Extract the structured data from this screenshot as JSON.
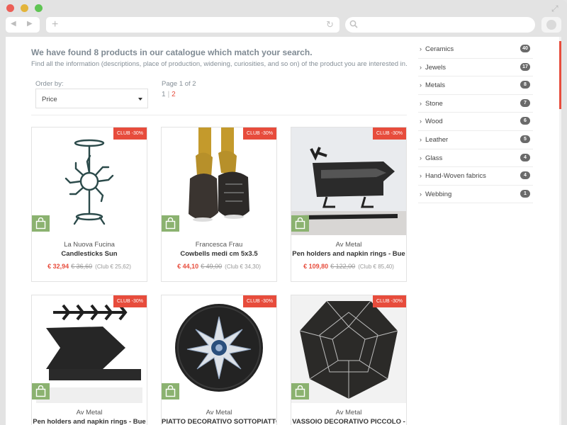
{
  "search": {
    "heading": "We have found 8 products in our catalogue which match your search.",
    "subheading": "Find all the information (descriptions, place of production, widening, curiosities, and so on) of the product you are interested in."
  },
  "order": {
    "label": "Order by:",
    "value": "Price"
  },
  "pagination": {
    "label": "Page 1 of 2",
    "current": "1",
    "separator": "|",
    "next": "2"
  },
  "products": [
    {
      "badge": "CLUB -30%",
      "maker": "La Nuova Fucina",
      "name": "Candlesticks Sun",
      "price": "€ 32,94",
      "old_price": "€ 36,60",
      "club_price": "(Club € 25,62)"
    },
    {
      "badge": "CLUB -30%",
      "maker": "Francesca Frau",
      "name": "Cowbells medi cm 5x3.5",
      "price": "€ 44,10",
      "old_price": "€ 49,00",
      "club_price": "(Club € 34,30)"
    },
    {
      "badge": "CLUB -30%",
      "maker": "Av Metal",
      "name": "Pen holders and napkin rings - Bue",
      "price": "€ 109,80",
      "old_price": "€ 122,00",
      "club_price": "(Club € 85,40)"
    },
    {
      "badge": "CLUB -30%",
      "maker": "Av Metal",
      "name": "Pen holders and napkin rings - Bue"
    },
    {
      "badge": "CLUB -30%",
      "maker": "Av Metal",
      "name": "PIATTO DECORATIVO SOTTOPIATTO"
    },
    {
      "badge": "CLUB -30%",
      "maker": "Av Metal",
      "name": "VASSOIO DECORATIVO PICCOLO -"
    }
  ],
  "categories": [
    {
      "label": "Ceramics",
      "count": "40"
    },
    {
      "label": "Jewels",
      "count": "17"
    },
    {
      "label": "Metals",
      "count": "8"
    },
    {
      "label": "Stone",
      "count": "7"
    },
    {
      "label": "Wood",
      "count": "6"
    },
    {
      "label": "Leather",
      "count": "5"
    },
    {
      "label": "Glass",
      "count": "4"
    },
    {
      "label": "Hand-Woven fabrics",
      "count": "4"
    },
    {
      "label": "Webbing",
      "count": "1"
    }
  ],
  "colors": {
    "accent": "#e74c3c",
    "cart": "#8bb270",
    "muted_text": "#858f97"
  }
}
